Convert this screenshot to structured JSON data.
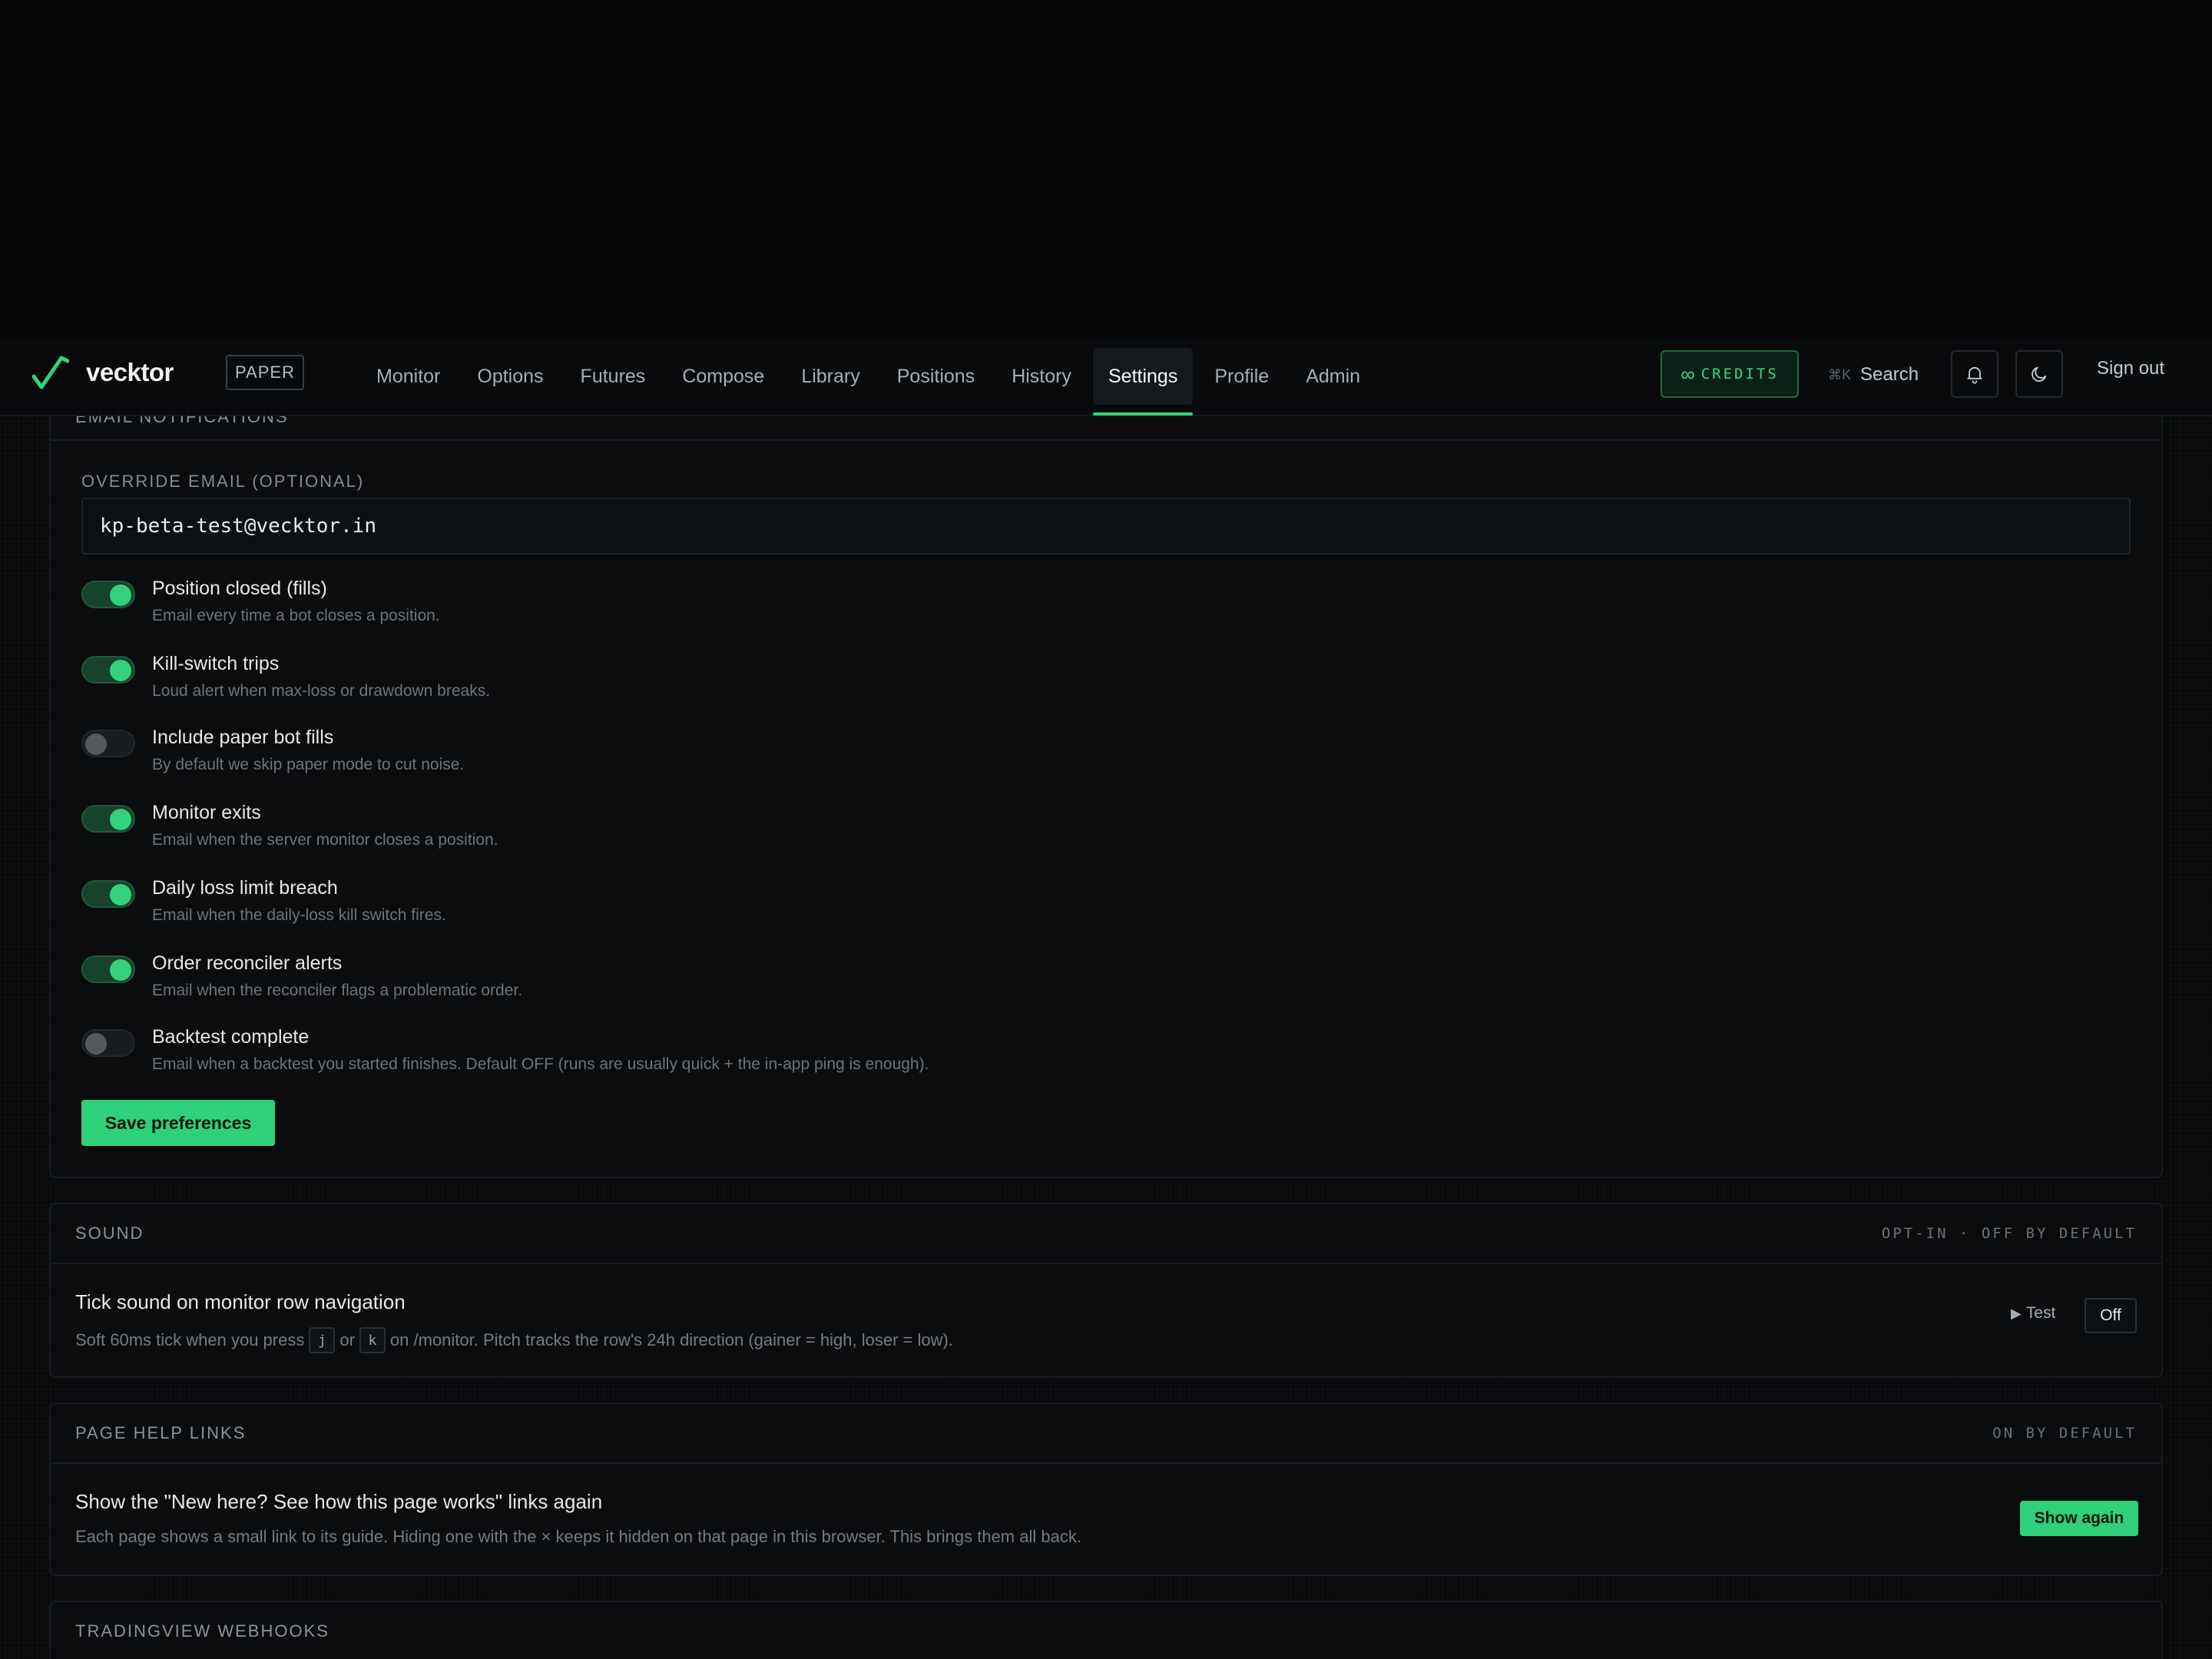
{
  "brand": {
    "name": "vecktor",
    "mode_badge": "PAPER",
    "accent": "#2fd07a"
  },
  "nav": {
    "tabs": [
      {
        "label": "Monitor"
      },
      {
        "label": "Options"
      },
      {
        "label": "Futures"
      },
      {
        "label": "Compose"
      },
      {
        "label": "Library"
      },
      {
        "label": "Positions"
      },
      {
        "label": "History"
      },
      {
        "label": "Settings",
        "active": true
      },
      {
        "label": "Profile"
      },
      {
        "label": "Admin"
      }
    ],
    "credits_symbol": "∞",
    "credits_label": "CREDITS",
    "search_shortcut": "⌘K",
    "search_label": "Search",
    "notifications_icon": "bell-icon",
    "theme_icon": "moon-icon",
    "signout_label": "Sign out"
  },
  "email_notifications": {
    "section_title": "EMAIL NOTIFICATIONS",
    "override_label": "OVERRIDE EMAIL (OPTIONAL)",
    "override_value": "kp-beta-test@vecktor.in",
    "toggles": [
      {
        "title": "Position closed (fills)",
        "desc": "Email every time a bot closes a position.",
        "on": true
      },
      {
        "title": "Kill-switch trips",
        "desc": "Loud alert when max-loss or drawdown breaks.",
        "on": true
      },
      {
        "title": "Include paper bot fills",
        "desc": "By default we skip paper mode to cut noise.",
        "on": false
      },
      {
        "title": "Monitor exits",
        "desc": "Email when the server monitor closes a position.",
        "on": true
      },
      {
        "title": "Daily loss limit breach",
        "desc": "Email when the daily-loss kill switch fires.",
        "on": true
      },
      {
        "title": "Order reconciler alerts",
        "desc": "Email when the reconciler flags a problematic order.",
        "on": true
      },
      {
        "title": "Backtest complete",
        "desc": "Email when a backtest you started finishes. Default OFF (runs are usually quick + the in-app ping is enough).",
        "on": false
      }
    ],
    "save_label": "Save preferences"
  },
  "sound": {
    "section_title": "SOUND",
    "tag": "OPT-IN · OFF BY DEFAULT",
    "row_title": "Tick sound on monitor row navigation",
    "desc_prefix": "Soft 60ms tick when you press",
    "key_j": "j",
    "desc_or": "or",
    "key_k": "k",
    "desc_suffix": "on /monitor. Pitch tracks the row's 24h direction (gainer = high, loser = low).",
    "test_label": "Test",
    "state_label": "Off"
  },
  "page_help": {
    "section_title": "PAGE HELP LINKS",
    "tag": "ON BY DEFAULT",
    "row_title": "Show the \"New here? See how this page works\" links again",
    "desc": "Each page shows a small link to its guide. Hiding one with the × keeps it hidden on that page in this browser. This brings them all back.",
    "button_label": "Show again"
  },
  "webhooks": {
    "section_title": "TRADINGVIEW WEBHOOKS"
  }
}
